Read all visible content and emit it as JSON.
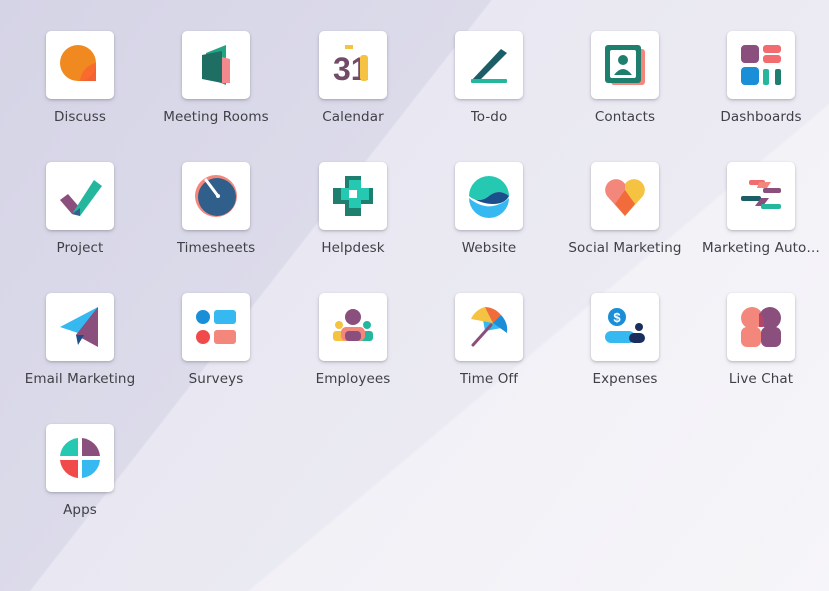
{
  "apps": [
    {
      "label": "Discuss",
      "icon": "discuss-icon"
    },
    {
      "label": "Meeting Rooms",
      "icon": "meeting-rooms-icon"
    },
    {
      "label": "Calendar",
      "icon": "calendar-icon",
      "icon_text": "31"
    },
    {
      "label": "To-do",
      "icon": "todo-icon"
    },
    {
      "label": "Contacts",
      "icon": "contacts-icon"
    },
    {
      "label": "Dashboards",
      "icon": "dashboards-icon"
    },
    {
      "label": "Project",
      "icon": "project-icon"
    },
    {
      "label": "Timesheets",
      "icon": "timesheets-icon"
    },
    {
      "label": "Helpdesk",
      "icon": "helpdesk-icon"
    },
    {
      "label": "Website",
      "icon": "website-icon"
    },
    {
      "label": "Social Marketing",
      "icon": "social-marketing-icon"
    },
    {
      "label": "Marketing Auto…",
      "icon": "marketing-automation-icon"
    },
    {
      "label": "Email Marketing",
      "icon": "email-marketing-icon"
    },
    {
      "label": "Surveys",
      "icon": "surveys-icon"
    },
    {
      "label": "Employees",
      "icon": "employees-icon"
    },
    {
      "label": "Time Off",
      "icon": "time-off-icon"
    },
    {
      "label": "Expenses",
      "icon": "expenses-icon",
      "icon_text": "$"
    },
    {
      "label": "Live Chat",
      "icon": "live-chat-icon"
    },
    {
      "label": "Apps",
      "icon": "apps-icon"
    }
  ]
}
